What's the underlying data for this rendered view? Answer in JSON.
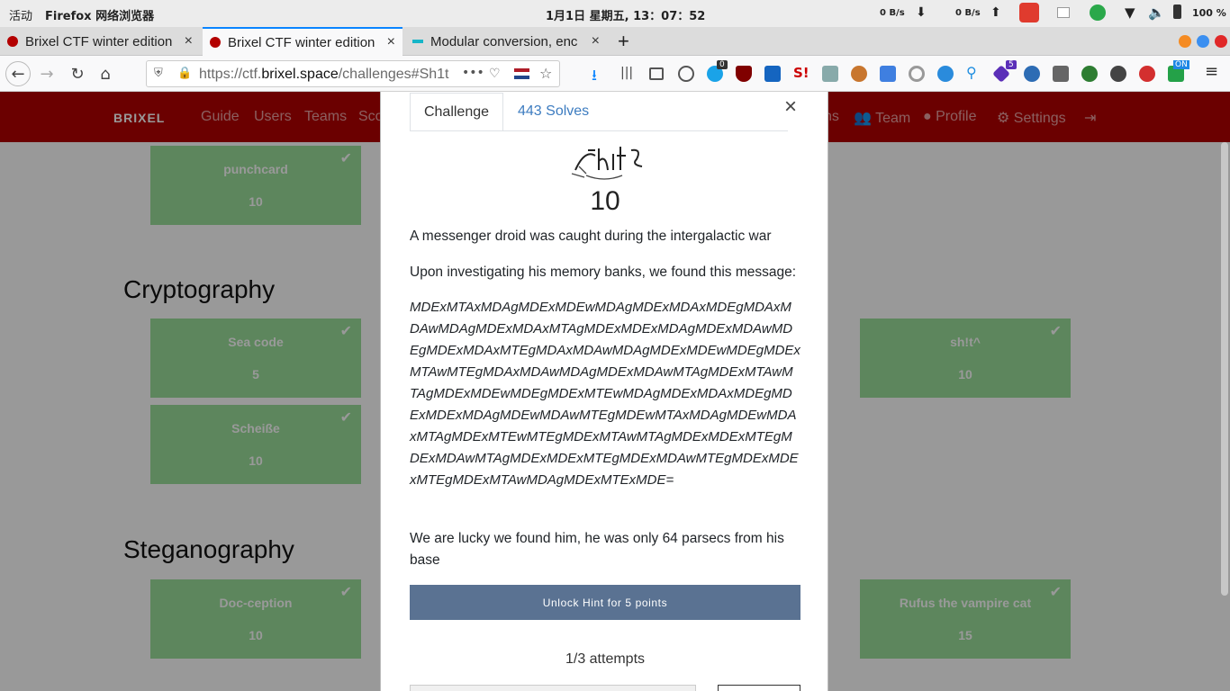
{
  "os_bar": {
    "activities": "活动",
    "app_name": "Firefox 网络浏览器",
    "clock": "1月1日 星期五, 13：07：52",
    "down_speed": "0 B/s",
    "up_speed": "0 B/s",
    "battery": "100 %"
  },
  "tabs": [
    {
      "title": "Brixel CTF winter edition",
      "close": "×"
    },
    {
      "title": "Brixel CTF winter edition",
      "close": "×"
    },
    {
      "title": "Modular conversion, enc",
      "close": "×"
    }
  ],
  "new_tab": "+",
  "url": {
    "prefix": "https://ctf.",
    "domain": "brixel.space",
    "path": "/challenges#Sh1t",
    "more": "•••"
  },
  "ext_badges": {
    "container_count": "0",
    "purple_count": "5",
    "on_label": "ON"
  },
  "site_nav": {
    "logo": "BRIXEL",
    "left_items": [
      "Guide",
      "Users",
      "Teams",
      "Sco"
    ],
    "right_items": [
      "ns",
      "Team",
      "Profile",
      "Settings"
    ]
  },
  "sections": {
    "crypto": "Cryptography",
    "stego": "Steganography"
  },
  "cards": {
    "punchcard": {
      "name": "punchcard",
      "value": "10"
    },
    "sea_code": {
      "name": "Sea code",
      "value": "5"
    },
    "scheisse": {
      "name": "Scheiße",
      "value": "10"
    },
    "garbled": {
      "name": "sh!t^",
      "value": "10"
    },
    "doc_ception": {
      "name": "Doc-ception",
      "value": "10"
    },
    "rufus": {
      "name": "Rufus the vampire cat",
      "value": "15"
    }
  },
  "modal": {
    "tab_challenge": "Challenge",
    "tab_solves": "443 Solves",
    "close": "×",
    "points": "10",
    "desc1": "A messenger droid was caught during the intergalactic war",
    "desc2": "Upon investigating his memory banks, we found this message:",
    "cipher": "MDExMTAxMDAgMDExMDEwMDAgMDExMDAxMDEgMDAxMDAwMDAgMDExMDAxMTAgMDExMDExMDAgMDExMDAwMDEgMDExMDAxMTEgMDAxMDAwMDAgMDExMDEwMDEgMDExMTAwMTEgMDAxMDAwMDAgMDExMDAwMTAgMDExMTAwMTAgMDExMDEwMDEgMDExMTEwMDAgMDExMDAxMDEgMDExMDExMDAgMDEwMDAwMTEgMDEwMTAxMDAgMDEwMDAxMTAgMDExMTEwMTEgMDExMTAwMTAgMDExMDExMTEgMDExMDAwMTAgMDExMDExMTEgMDExMDAwMTEgMDExMDExMTEgMDExMTAwMDAgMDExMTExMDE=",
    "desc3": "We are lucky we found him, he was only 64 parsecs from his base",
    "hint_button": "Unlock Hint for 5 points",
    "attempts": "1/3 attempts"
  }
}
